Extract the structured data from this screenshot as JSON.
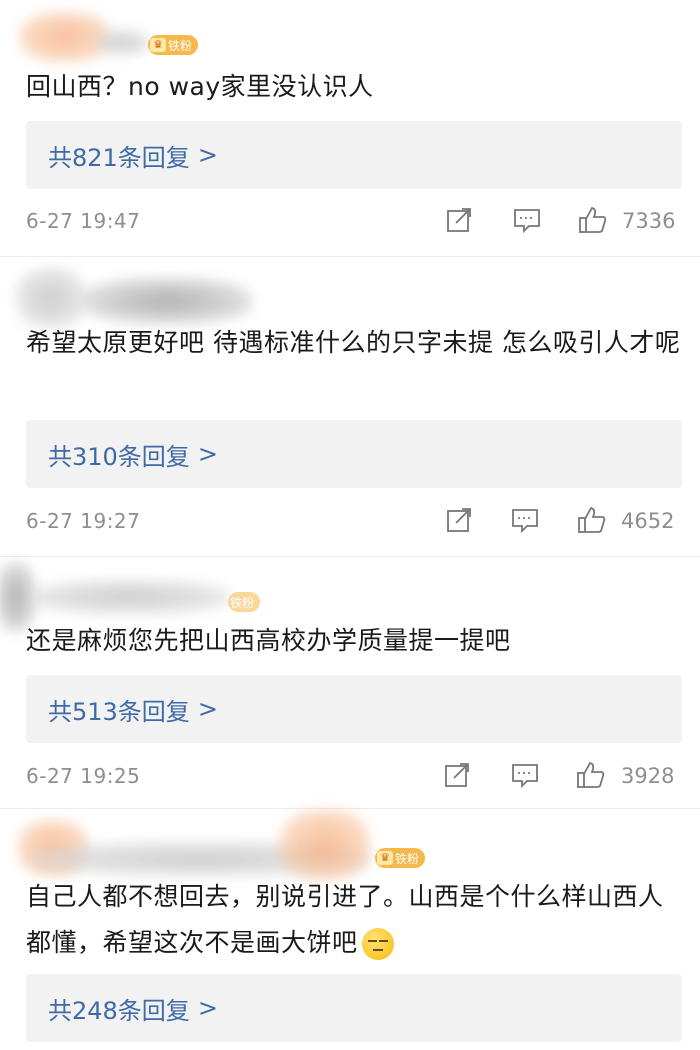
{
  "colors": {
    "reply_link": "#3e6aa6",
    "meta_gray": "#8e8e8e",
    "reply_bg": "#f2f2f2",
    "badge": "#f6b84a"
  },
  "icons": {
    "share": "share-icon",
    "comment": "comment-icon",
    "like": "thumbs-up-icon"
  },
  "comments": [
    {
      "badge": "铁粉",
      "text": "回山西？no way家里没认识人",
      "replies_label": "共821条回复",
      "chevron": ">",
      "time": "6-27 19:47",
      "likes": "7336"
    },
    {
      "text": "希望太原更好吧 待遇标准什么的只字未提 怎么吸引人才呢",
      "replies_label": "共310条回复",
      "chevron": ">",
      "time": "6-27 19:27",
      "likes": "4652"
    },
    {
      "badge": "铁粉",
      "text": "还是麻烦您先把山西高校办学质量提一提吧",
      "replies_label": "共513条回复",
      "chevron": ">",
      "time": "6-27 19:25",
      "likes": "3928"
    },
    {
      "badge": "铁粉",
      "text": "自己人都不想回去，别说引进了。山西是个什么样山西人都懂，希望这次不是画大饼吧",
      "replies_label": "共248条回复",
      "chevron": ">"
    }
  ]
}
